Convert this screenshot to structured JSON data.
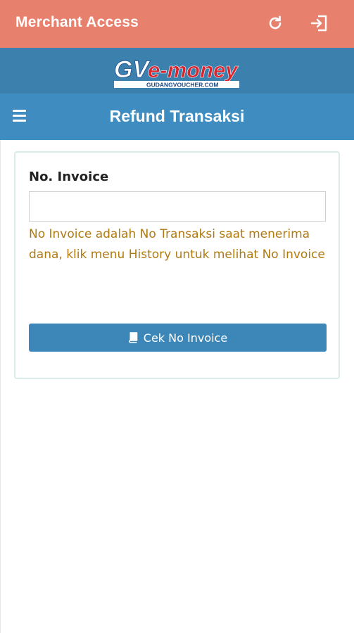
{
  "app_bar": {
    "title": "Merchant Access",
    "refresh_icon": "refresh-icon",
    "logout_icon": "logout-icon"
  },
  "brand": {
    "logo_main": "GVe-money",
    "logo_sub": "GUDANGVOUCHER.COM",
    "colors": {
      "gv": "#ffffff",
      "money": "#d9232d",
      "sub": "#1e4a8a"
    }
  },
  "header": {
    "menu_icon": "hamburger-menu-icon",
    "title": "Refund Transaksi"
  },
  "form": {
    "label": "No. Invoice",
    "input_value": "",
    "input_placeholder": "",
    "help_text": "No Invoice adalah No Transaksi saat menerima dana, klik menu History untuk melihat No Invoice",
    "button_label": "Cek No Invoice",
    "button_icon": "book-icon"
  },
  "colors": {
    "app_bar": "#e8806e",
    "logo_band": "#3c80ad",
    "title_bar": "#3f8cc0",
    "button": "#3c86b8",
    "help_text": "#b07a10",
    "card_border": "#d9ecea"
  }
}
